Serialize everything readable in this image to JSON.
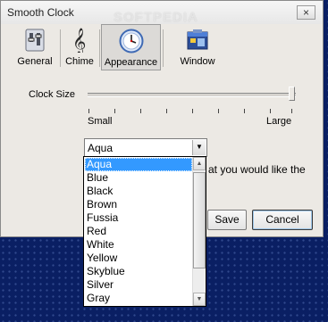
{
  "window": {
    "title": "Smooth Clock",
    "close_glyph": "×"
  },
  "watermark": "SOFTPEDIA",
  "toolbar": {
    "tabs": [
      {
        "label": "General",
        "icon": "switches-icon",
        "active": false
      },
      {
        "label": "Chime",
        "icon": "treble-clef-icon",
        "active": false
      },
      {
        "label": "Appearance",
        "icon": "clock-icon",
        "active": true
      },
      {
        "label": "Window",
        "icon": "window-icon",
        "active": false
      }
    ]
  },
  "clock_size": {
    "label": "Clock Size",
    "min_label": "Small",
    "max_label": "Large",
    "value_fraction": 1.0
  },
  "style_select": {
    "value": "Aqua",
    "arrow_glyph": "▼",
    "options": [
      "Aqua",
      "Blue",
      "Black",
      "Brown",
      "Fussia",
      "Red",
      "White",
      "Yellow",
      "Skyblue",
      "Silver",
      "Gray"
    ],
    "selected_index": 0
  },
  "hint_text": "at you would like the",
  "buttons": {
    "save": "Save",
    "cancel": "Cancel"
  },
  "scrollbar": {
    "up_glyph": "▲",
    "down_glyph": "▼"
  }
}
